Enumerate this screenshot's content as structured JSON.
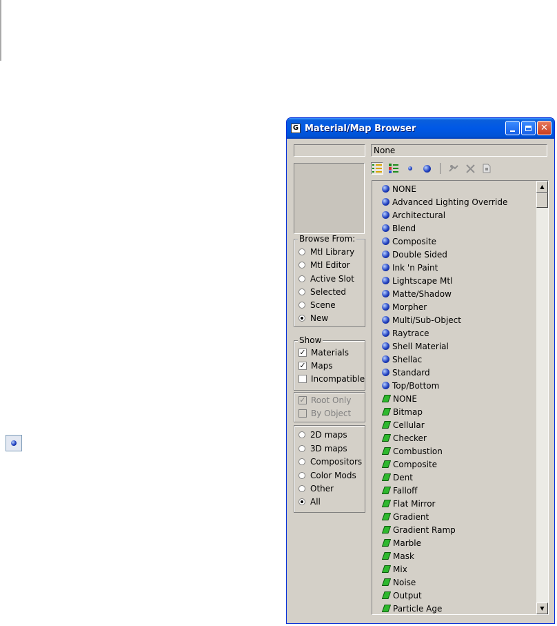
{
  "window": {
    "title": "Material/Map Browser",
    "icon": "G"
  },
  "name_field": {
    "value": ""
  },
  "type_display": "None",
  "browse_from": {
    "label": "Browse From:",
    "options": [
      "Mtl Library",
      "Mtl Editor",
      "Active Slot",
      "Selected",
      "Scene",
      "New"
    ],
    "selected": "New"
  },
  "show": {
    "label": "Show",
    "materials": "Materials",
    "maps": "Maps",
    "incompatible": "Incompatible",
    "materials_checked": true,
    "maps_checked": true,
    "incompatible_checked": false
  },
  "root_only": "Root Only",
  "by_object": "By Object",
  "map_filter": {
    "options": [
      "2D maps",
      "3D maps",
      "Compositors",
      "Color Mods",
      "Other",
      "All"
    ],
    "selected": "All"
  },
  "materials": [
    "NONE",
    "Advanced Lighting Override",
    "Architectural",
    "Blend",
    "Composite",
    "Double Sided",
    "Ink 'n Paint",
    "Lightscape Mtl",
    "Matte/Shadow",
    "Morpher",
    "Multi/Sub-Object",
    "Raytrace",
    "Shell Material",
    "Shellac",
    "Standard",
    "Top/Bottom"
  ],
  "maps": [
    "NONE",
    "Bitmap",
    "Cellular",
    "Checker",
    "Combustion",
    "Composite",
    "Dent",
    "Falloff",
    "Flat Mirror",
    "Gradient",
    "Gradient Ramp",
    "Marble",
    "Mask",
    "Mix",
    "Noise",
    "Output",
    "Particle Age"
  ],
  "colors": {
    "title_blue": "#0058e6",
    "panel": "#d4d0c8",
    "map_green": "#2eb82e",
    "material_blue": "#2040c0"
  }
}
